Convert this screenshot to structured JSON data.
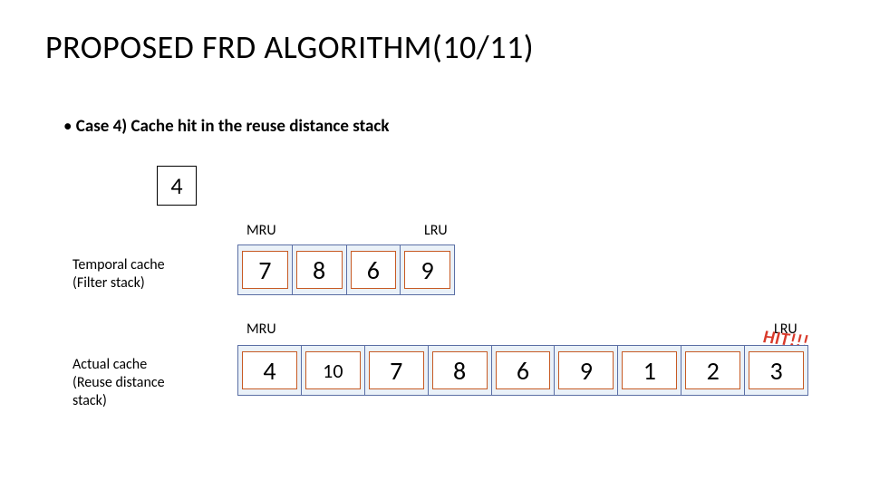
{
  "title": "PROPOSED FRD ALGORITHM(10/11)",
  "bullet": "Case 4) Cache hit in the reuse distance stack",
  "input_value": "4",
  "labels": {
    "temporal": "Temporal cache\n(Filter stack)",
    "actual": "Actual cache\n(Reuse distance\nstack)",
    "mru": "MRU",
    "lru": "LRU",
    "hit": "HIT!!!"
  },
  "stacks": {
    "filter": [
      "7",
      "8",
      "6",
      "9"
    ],
    "reuse": [
      "4",
      "10",
      "7",
      "8",
      "6",
      "9",
      "1",
      "2",
      "3"
    ]
  }
}
